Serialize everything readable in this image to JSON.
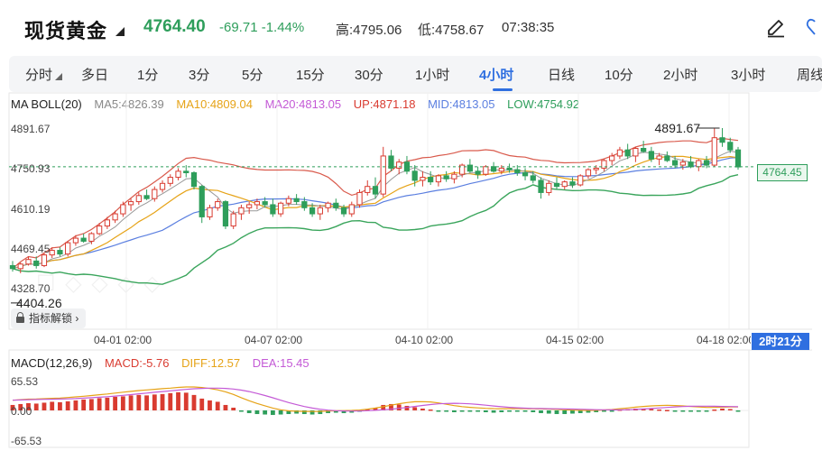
{
  "header": {
    "title": "现货黄金",
    "price": "4764.40",
    "change": "-69.71 -1.44%",
    "high": "高:4795.06",
    "low": "低:4758.67",
    "time": "07:38:35",
    "colors": {
      "down": "#2e9e5b",
      "up": "#d93b30",
      "accent": "#2f6fe0"
    }
  },
  "tabs": {
    "items": [
      "分时",
      "多日",
      "1分",
      "3分",
      "5分",
      "15分",
      "30分",
      "1小时",
      "4小时",
      "日线",
      "10分",
      "2小时",
      "3小时",
      "周线"
    ],
    "active": "4小时"
  },
  "legend": {
    "indicator": "MA BOLL(20)",
    "ma5": "MA5:4826.39",
    "ma10": "MA10:4809.04",
    "ma20": "MA20:4813.05",
    "up": "UP:4871.18",
    "mid": "MID:4813.05",
    "low": "LOW:4754.92"
  },
  "annotations": {
    "max_label": "4891.67",
    "min_label": "4404.26",
    "current_price_tag": "4764.45",
    "countdown": "2时21分",
    "indicator_unlock": "指标解锁"
  },
  "macd_legend": {
    "title": "MACD(12,26,9)",
    "macd": "MACD:-5.76",
    "diff": "DIFF:12.57",
    "dea": "DEA:15.45"
  },
  "chart_data": [
    {
      "type": "candlestick",
      "y_tick_labels": [
        "4891.67",
        "4750.93",
        "4610.19",
        "4469.45",
        "4328.70"
      ],
      "ylim": [
        4328.7,
        4891.67
      ],
      "x_tick_labels": [
        "04-01 02:00",
        "04-07 02:00",
        "04-10 02:00",
        "04-15 02:00",
        "04-18 02:00"
      ],
      "current_price": 4764.45,
      "candles": [
        [
          4440,
          4455,
          4420,
          4430
        ],
        [
          4430,
          4450,
          4415,
          4445
        ],
        [
          4445,
          4470,
          4440,
          4460
        ],
        [
          4455,
          4470,
          4430,
          4440
        ],
        [
          4440,
          4480,
          4435,
          4475
        ],
        [
          4475,
          4500,
          4465,
          4490
        ],
        [
          4490,
          4500,
          4470,
          4478
        ],
        [
          4478,
          4520,
          4470,
          4515
        ],
        [
          4515,
          4540,
          4505,
          4530
        ],
        [
          4530,
          4545,
          4515,
          4520
        ],
        [
          4520,
          4550,
          4510,
          4545
        ],
        [
          4545,
          4580,
          4540,
          4570
        ],
        [
          4570,
          4600,
          4560,
          4590
        ],
        [
          4590,
          4620,
          4580,
          4610
        ],
        [
          4610,
          4650,
          4600,
          4640
        ],
        [
          4640,
          4660,
          4620,
          4650
        ],
        [
          4650,
          4680,
          4640,
          4670
        ],
        [
          4670,
          4690,
          4655,
          4660
        ],
        [
          4660,
          4700,
          4650,
          4690
        ],
        [
          4690,
          4720,
          4680,
          4710
        ],
        [
          4710,
          4740,
          4700,
          4730
        ],
        [
          4730,
          4760,
          4720,
          4750
        ],
        [
          4750,
          4770,
          4730,
          4745
        ],
        [
          4745,
          4750,
          4690,
          4700
        ],
        [
          4700,
          4705,
          4580,
          4600
        ],
        [
          4600,
          4640,
          4590,
          4630
        ],
        [
          4630,
          4660,
          4620,
          4650
        ],
        [
          4650,
          4655,
          4560,
          4570
        ],
        [
          4570,
          4620,
          4560,
          4610
        ],
        [
          4610,
          4640,
          4590,
          4630
        ],
        [
          4630,
          4650,
          4610,
          4640
        ],
        [
          4640,
          4660,
          4625,
          4650
        ],
        [
          4650,
          4665,
          4630,
          4640
        ],
        [
          4640,
          4660,
          4600,
          4610
        ],
        [
          4610,
          4650,
          4600,
          4645
        ],
        [
          4645,
          4670,
          4635,
          4660
        ],
        [
          4660,
          4675,
          4640,
          4650
        ],
        [
          4650,
          4665,
          4620,
          4630
        ],
        [
          4630,
          4645,
          4600,
          4610
        ],
        [
          4610,
          4640,
          4590,
          4630
        ],
        [
          4630,
          4650,
          4615,
          4645
        ],
        [
          4645,
          4660,
          4620,
          4630
        ],
        [
          4630,
          4640,
          4600,
          4610
        ],
        [
          4610,
          4650,
          4600,
          4640
        ],
        [
          4640,
          4690,
          4630,
          4680
        ],
        [
          4680,
          4720,
          4670,
          4700
        ],
        [
          4700,
          4730,
          4660,
          4675
        ],
        [
          4675,
          4830,
          4665,
          4800
        ],
        [
          4800,
          4820,
          4750,
          4760
        ],
        [
          4760,
          4790,
          4740,
          4780
        ],
        [
          4780,
          4800,
          4740,
          4750
        ],
        [
          4750,
          4770,
          4700,
          4720
        ],
        [
          4720,
          4750,
          4700,
          4730
        ],
        [
          4730,
          4750,
          4705,
          4715
        ],
        [
          4715,
          4740,
          4700,
          4735
        ],
        [
          4735,
          4750,
          4715,
          4725
        ],
        [
          4725,
          4750,
          4710,
          4740
        ],
        [
          4740,
          4775,
          4730,
          4770
        ],
        [
          4770,
          4790,
          4745,
          4750
        ],
        [
          4750,
          4765,
          4725,
          4740
        ],
        [
          4740,
          4770,
          4735,
          4765
        ],
        [
          4765,
          4780,
          4745,
          4750
        ],
        [
          4750,
          4770,
          4740,
          4760
        ],
        [
          4760,
          4775,
          4745,
          4755
        ],
        [
          4755,
          4770,
          4735,
          4745
        ],
        [
          4745,
          4760,
          4720,
          4735
        ],
        [
          4735,
          4750,
          4710,
          4720
        ],
        [
          4720,
          4730,
          4660,
          4680
        ],
        [
          4680,
          4720,
          4670,
          4710
        ],
        [
          4710,
          4730,
          4690,
          4700
        ],
        [
          4700,
          4720,
          4690,
          4715
        ],
        [
          4715,
          4730,
          4695,
          4705
        ],
        [
          4705,
          4740,
          4700,
          4735
        ],
        [
          4735,
          4760,
          4725,
          4755
        ],
        [
          4755,
          4770,
          4740,
          4760
        ],
        [
          4760,
          4790,
          4750,
          4785
        ],
        [
          4785,
          4810,
          4770,
          4800
        ],
        [
          4800,
          4830,
          4790,
          4820
        ],
        [
          4820,
          4840,
          4790,
          4800
        ],
        [
          4800,
          4830,
          4780,
          4825
        ],
        [
          4825,
          4850,
          4810,
          4815
        ],
        [
          4815,
          4830,
          4780,
          4790
        ],
        [
          4790,
          4810,
          4770,
          4800
        ],
        [
          4800,
          4815,
          4780,
          4785
        ],
        [
          4785,
          4800,
          4760,
          4770
        ],
        [
          4770,
          4790,
          4755,
          4780
        ],
        [
          4780,
          4800,
          4760,
          4765
        ],
        [
          4765,
          4790,
          4750,
          4785
        ],
        [
          4785,
          4800,
          4760,
          4770
        ],
        [
          4770,
          4890,
          4765,
          4860
        ],
        [
          4860,
          4891.67,
          4830,
          4845
        ],
        [
          4845,
          4860,
          4810,
          4820
        ],
        [
          4820,
          4830,
          4755,
          4764
        ]
      ]
    },
    {
      "type": "bar",
      "title": "MACD(12,26,9)",
      "y_tick_labels": [
        "65.53",
        "0.00",
        "-65.53"
      ],
      "ylim": [
        -65.53,
        65.53
      ],
      "macd_values": [
        12,
        14,
        16,
        15,
        17,
        19,
        18,
        20,
        22,
        24,
        25,
        27,
        28,
        30,
        31,
        33,
        34,
        33,
        35,
        36,
        38,
        40,
        39,
        34,
        26,
        22,
        19,
        12,
        6,
        -2,
        -6,
        -8,
        -9,
        -10,
        -9,
        -8,
        -7,
        -8,
        -9,
        -8,
        -6,
        -5,
        -6,
        -5,
        -3,
        2,
        6,
        12,
        14,
        13,
        10,
        7,
        4,
        2,
        -1,
        -3,
        -4,
        -3,
        -2,
        -3,
        -4,
        -5,
        -4,
        -3,
        -2,
        -3,
        -4,
        -6,
        -7,
        -8,
        -8,
        -7,
        -6,
        -5,
        -4,
        -3,
        -2,
        2,
        3,
        4,
        4,
        3,
        2,
        1,
        -1,
        -2,
        -3,
        -2,
        -3,
        2,
        4,
        3,
        -3
      ]
    }
  ]
}
